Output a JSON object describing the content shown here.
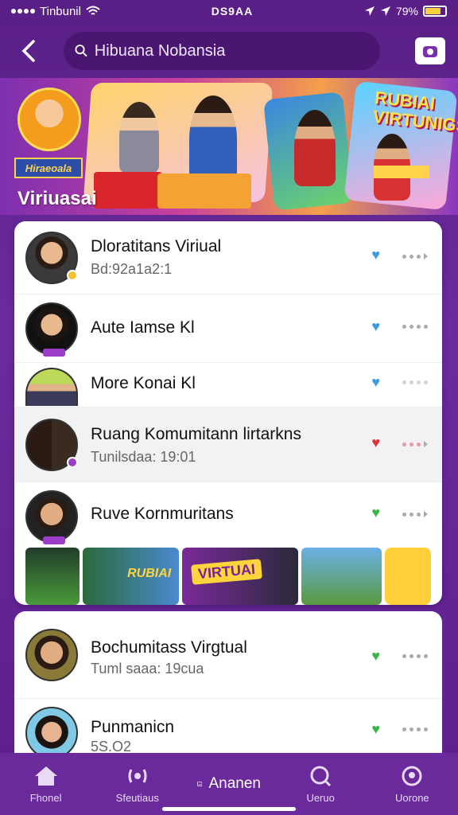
{
  "status_bar": {
    "carrier": "Tinbunil",
    "time": "DS9AA",
    "battery": "79%",
    "battery_level": 0.79
  },
  "header": {
    "search_placeholder": "Hibuana Nobansia"
  },
  "banner": {
    "title": "Viriuasai",
    "badge": "Hiraeoala",
    "vtitle": "RUBIAI VIRTUNIGS"
  },
  "list": [
    {
      "name": "Dloratitans Viriual",
      "sub": "Bd:92a1a2:1",
      "heart": "blue"
    },
    {
      "name": "Aute Iamse Kl",
      "sub": "",
      "heart": "blue"
    },
    {
      "name": "More Konai Kl",
      "sub": "",
      "heart": "blue"
    },
    {
      "name": "Ruang Komumitann lirtarkns",
      "sub": "Tunilsdaa: 19:01",
      "heart": "red"
    },
    {
      "name": "Ruve Kornmuritans",
      "sub": "",
      "heart": "green"
    }
  ],
  "list2": [
    {
      "name": "Bochumitass Virgtual",
      "sub": "Tuml saaa: 19cua",
      "heart": "green"
    },
    {
      "name": "Punmanicn",
      "sub": "5S.O2",
      "heart": "green"
    }
  ],
  "promo": {
    "word1": "RUBIAI",
    "word2": "VIRTUAI"
  },
  "nav": {
    "home": "Fhonel",
    "stations": "Sfeutiaus",
    "center": "Ananen",
    "group": "Ueruo",
    "profile": "Uorone"
  },
  "colors": {
    "background": "#6b2a9e",
    "heart_blue": "#3a9be0",
    "heart_red": "#e0303a",
    "heart_green": "#3cb44a"
  }
}
